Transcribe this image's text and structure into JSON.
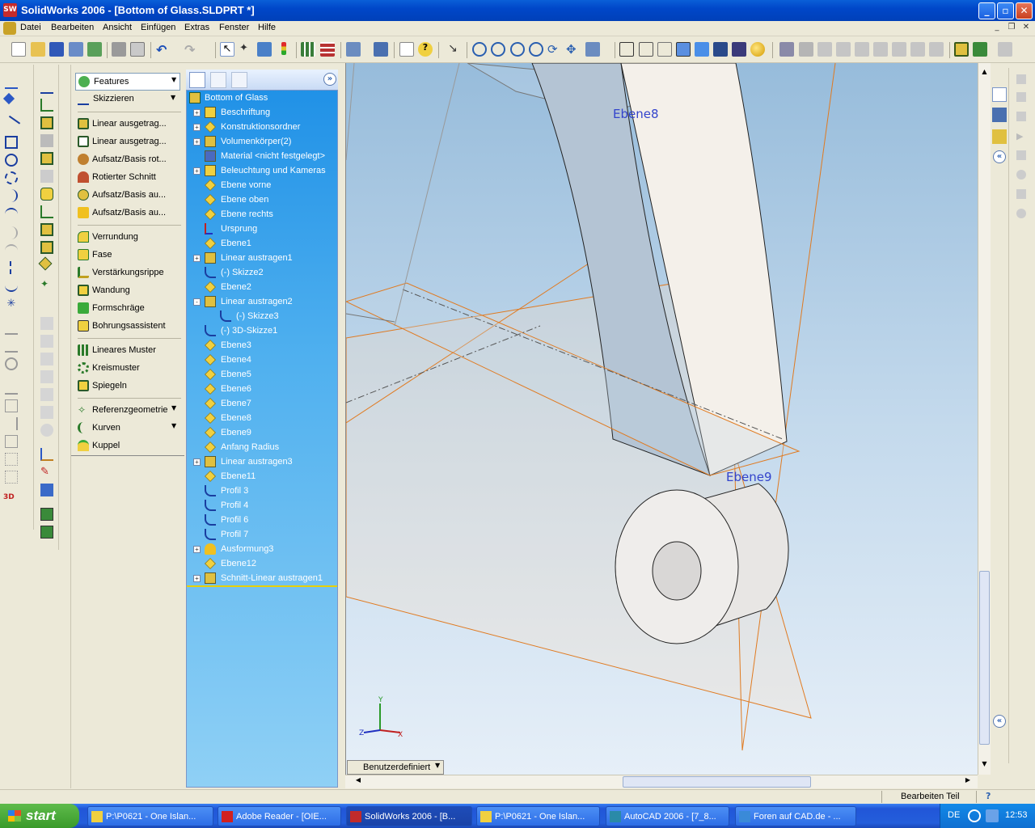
{
  "window": {
    "title": "SolidWorks 2006 - [Bottom of Glass.SLDPRT *]",
    "app_icon": "SW"
  },
  "menubar": {
    "items": [
      "Datei",
      "Bearbeiten",
      "Ansicht",
      "Einfügen",
      "Extras",
      "Fenster",
      "Hilfe"
    ]
  },
  "command_manager": {
    "dropdowns": [
      {
        "label": "Features",
        "icon": "features-icon"
      },
      {
        "label": "Skizzieren",
        "icon": "sketch-icon"
      }
    ],
    "items": [
      {
        "label": "Linear ausgetrag...",
        "icon": "extruded-boss-icon"
      },
      {
        "label": "Linear ausgetrag...",
        "icon": "extruded-cut-icon"
      },
      {
        "label": "Aufsatz/Basis rot...",
        "icon": "revolved-boss-icon"
      },
      {
        "label": "Rotierter Schnitt",
        "icon": "revolved-cut-icon"
      },
      {
        "label": "Aufsatz/Basis au...",
        "icon": "swept-boss-icon"
      },
      {
        "label": "Aufsatz/Basis au...",
        "icon": "lofted-boss-icon"
      },
      {
        "label": "Verrundung",
        "icon": "fillet-icon"
      },
      {
        "label": "Fase",
        "icon": "chamfer-icon"
      },
      {
        "label": "Verstärkungsrippe",
        "icon": "rib-icon"
      },
      {
        "label": "Wandung",
        "icon": "shell-icon"
      },
      {
        "label": "Formschräge",
        "icon": "draft-icon"
      },
      {
        "label": "Bohrungsassistent",
        "icon": "hole-wizard-icon"
      },
      {
        "label": "Lineares Muster",
        "icon": "linear-pattern-icon"
      },
      {
        "label": "Kreismuster",
        "icon": "circular-pattern-icon"
      },
      {
        "label": "Spiegeln",
        "icon": "mirror-icon"
      },
      {
        "label": "Referenzgeometrie",
        "icon": "reference-geometry-icon"
      },
      {
        "label": "Kurven",
        "icon": "curves-icon"
      },
      {
        "label": "Kuppel",
        "icon": "dome-icon"
      }
    ]
  },
  "feature_tree": {
    "root": "Bottom of Glass",
    "items": [
      {
        "label": "Beschriftung",
        "expand": "+",
        "indent": 0
      },
      {
        "label": "Konstruktionsordner",
        "expand": "+",
        "indent": 0
      },
      {
        "label": "Volumenkörper(2)",
        "expand": "+",
        "indent": 0
      },
      {
        "label": "Material <nicht festgelegt>",
        "expand": "",
        "indent": 0
      },
      {
        "label": "Beleuchtung und Kameras",
        "expand": "+",
        "indent": 0
      },
      {
        "label": "Ebene vorne",
        "expand": "",
        "indent": 0
      },
      {
        "label": "Ebene oben",
        "expand": "",
        "indent": 0
      },
      {
        "label": "Ebene rechts",
        "expand": "",
        "indent": 0
      },
      {
        "label": "Ursprung",
        "expand": "",
        "indent": 0
      },
      {
        "label": "Ebene1",
        "expand": "",
        "indent": 0
      },
      {
        "label": "Linear austragen1",
        "expand": "+",
        "indent": 0
      },
      {
        "label": "(-) Skizze2",
        "expand": "",
        "indent": 0
      },
      {
        "label": "Ebene2",
        "expand": "",
        "indent": 0
      },
      {
        "label": "Linear austragen2",
        "expand": "-",
        "indent": 0
      },
      {
        "label": "(-) Skizze3",
        "expand": "",
        "indent": 1
      },
      {
        "label": "(-) 3D-Skizze1",
        "expand": "",
        "indent": 0
      },
      {
        "label": "Ebene3",
        "expand": "",
        "indent": 0
      },
      {
        "label": "Ebene4",
        "expand": "",
        "indent": 0
      },
      {
        "label": "Ebene5",
        "expand": "",
        "indent": 0
      },
      {
        "label": "Ebene6",
        "expand": "",
        "indent": 0
      },
      {
        "label": "Ebene7",
        "expand": "",
        "indent": 0
      },
      {
        "label": "Ebene8",
        "expand": "",
        "indent": 0
      },
      {
        "label": "Ebene9",
        "expand": "",
        "indent": 0
      },
      {
        "label": "Anfang Radius",
        "expand": "",
        "indent": 0
      },
      {
        "label": "Linear austragen3",
        "expand": "+",
        "indent": 0
      },
      {
        "label": "Ebene11",
        "expand": "",
        "indent": 0
      },
      {
        "label": "Profil 3",
        "expand": "",
        "indent": 0
      },
      {
        "label": "Profil 4",
        "expand": "",
        "indent": 0
      },
      {
        "label": "Profil 6",
        "expand": "",
        "indent": 0
      },
      {
        "label": "Profil 7",
        "expand": "",
        "indent": 0
      },
      {
        "label": "Ausformung3",
        "expand": "+",
        "indent": 0
      },
      {
        "label": "Ebene12",
        "expand": "",
        "indent": 0
      },
      {
        "label": "Schnitt-Linear austragen1",
        "expand": "+",
        "indent": 0
      }
    ]
  },
  "viewport": {
    "plane_labels": [
      "Ebene8",
      "Ebene9"
    ],
    "view_orientation": "Benutzerdefiniert",
    "triad": {
      "x": "X",
      "y": "Y",
      "z": "Z"
    }
  },
  "statusbar": {
    "mode": "Bearbeiten Teil",
    "help_icon": "?"
  },
  "taskbar": {
    "start": "start",
    "tasks": [
      {
        "label": "P:\\P0621 - One Islan...",
        "icon": "folder-icon",
        "active": false
      },
      {
        "label": "Adobe Reader - [OIE...",
        "icon": "adobe-reader-icon",
        "active": false
      },
      {
        "label": "SolidWorks 2006 - [B...",
        "icon": "solidworks-icon",
        "active": true
      },
      {
        "label": "P:\\P0621 - One Islan...",
        "icon": "folder-icon",
        "active": false
      },
      {
        "label": "AutoCAD 2006 - [7_8...",
        "icon": "autocad-icon",
        "active": false
      },
      {
        "label": "Foren auf CAD.de - ...",
        "icon": "browser-icon",
        "active": false
      }
    ],
    "language": "DE",
    "clock": "12:53"
  },
  "colors": {
    "title_blue": "#0a5fd8",
    "tree_blue": "#1d8fe6",
    "plane_orange": "#e07a20",
    "plane_label": "#3344cc"
  }
}
